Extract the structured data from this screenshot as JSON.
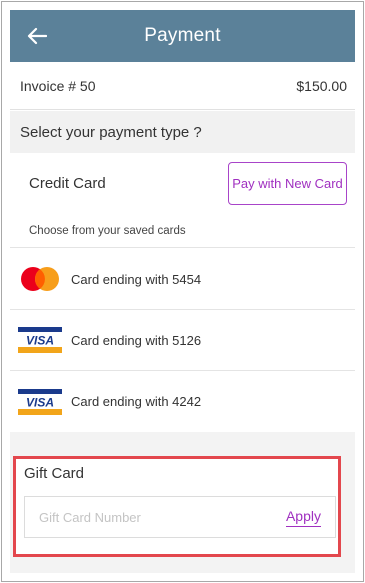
{
  "header": {
    "title": "Payment",
    "back_icon": "arrow-left-icon"
  },
  "invoice": {
    "label": "Invoice # 50",
    "amount": "$150.00"
  },
  "select_prompt": "Select your payment type ?",
  "credit_card": {
    "label": "Credit Card",
    "new_card_button": "Pay with New Card"
  },
  "saved_cards_heading": "Choose from your saved cards",
  "saved_cards": [
    {
      "brand": "mastercard",
      "icon": "mastercard-icon",
      "label": "Card ending with 5454"
    },
    {
      "brand": "visa",
      "icon": "visa-icon",
      "label": "Card ending with 5126"
    },
    {
      "brand": "visa",
      "icon": "visa-icon",
      "label": "Card ending with 4242"
    }
  ],
  "gift_card": {
    "title": "Gift Card",
    "input_placeholder": "Gift Card Number",
    "input_value": "",
    "apply_label": "Apply"
  },
  "colors": {
    "header_bg": "#5b8199",
    "accent_purple": "#a030c0",
    "highlight_red": "#e3474d",
    "visa_blue": "#1a3a8c",
    "visa_orange": "#f2a51a",
    "mastercard_red": "#eb001b",
    "mastercard_orange": "#f79e1b"
  }
}
